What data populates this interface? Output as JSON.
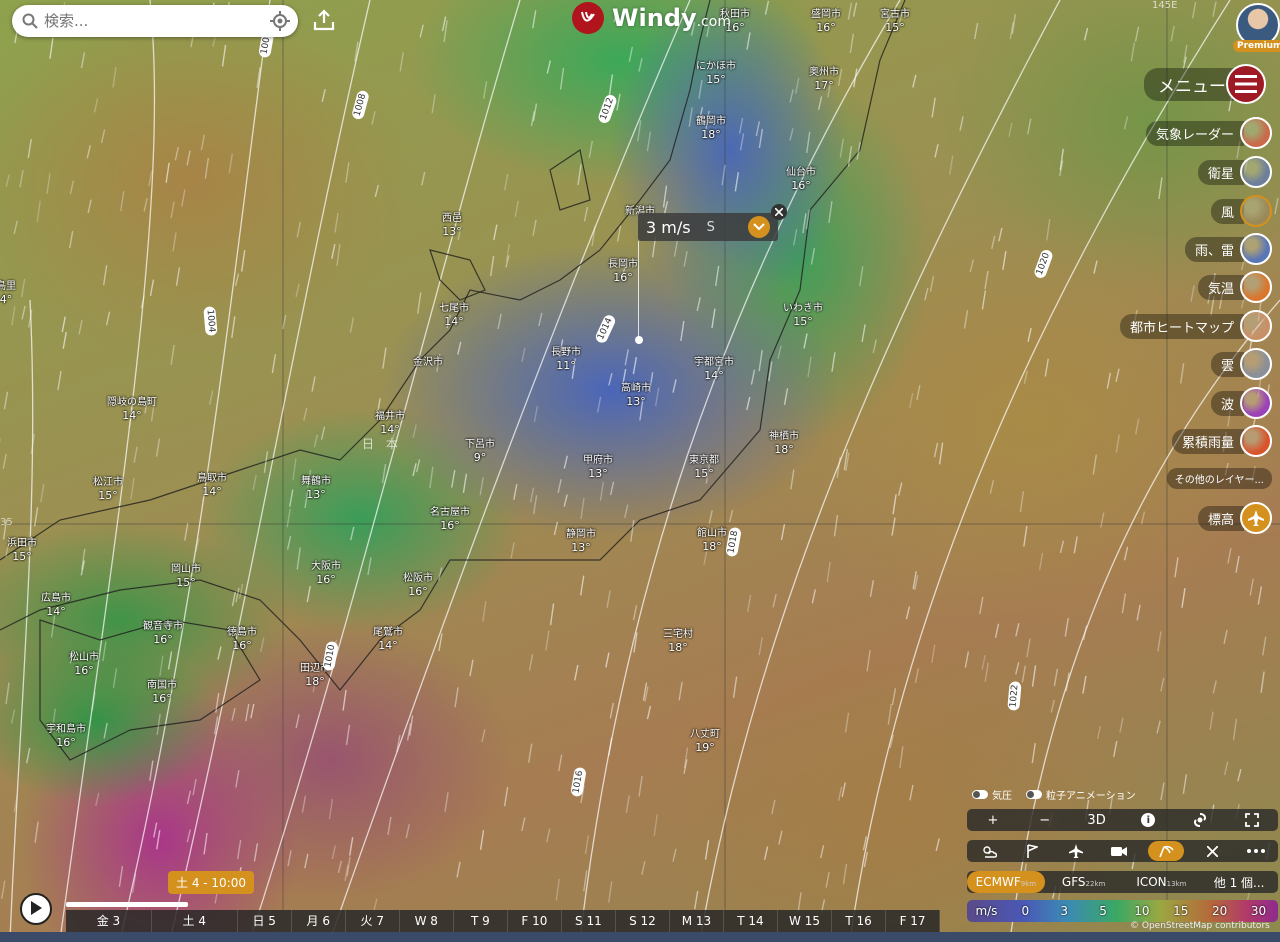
{
  "search": {
    "placeholder": "検索..."
  },
  "logo": {
    "brand": "Windy",
    "suffix": ".com"
  },
  "premium": "Premium",
  "menu": {
    "label": "メニュー"
  },
  "layers": [
    {
      "name": "radar",
      "label": "気象レーダー",
      "color": "#c96a4a"
    },
    {
      "name": "satellite",
      "label": "衛星",
      "color": "#6d7f9a"
    },
    {
      "name": "wind",
      "label": "風",
      "color": "#9a8a5a",
      "active": true
    },
    {
      "name": "rain",
      "label": "雨、雷",
      "color": "#5a76b5"
    },
    {
      "name": "temp",
      "label": "気温",
      "color": "#d9772e"
    },
    {
      "name": "heatmap",
      "label": "都市ヒートマップ",
      "color": "#c99068"
    },
    {
      "name": "clouds",
      "label": "雲",
      "color": "#8a8f98"
    },
    {
      "name": "waves",
      "label": "波",
      "color": "#9b42b8"
    },
    {
      "name": "accum",
      "label": "累積雨量",
      "color": "#d8552c"
    }
  ],
  "more_layers": "その他のレイヤー...",
  "elevation": {
    "label": "標高"
  },
  "popup": {
    "value": "3 m/s",
    "direction": "S"
  },
  "cities": [
    {
      "name": "秋田市",
      "temp": "16°"
    },
    {
      "name": "盛岡市",
      "temp": "16°"
    },
    {
      "name": "宮古市",
      "temp": "15°"
    },
    {
      "name": "にかほ市",
      "temp": "15°"
    },
    {
      "name": "奥州市",
      "temp": "17°"
    },
    {
      "name": "鶴岡市",
      "temp": "18°"
    },
    {
      "name": "仙台市",
      "temp": "16°"
    },
    {
      "name": "新潟市",
      "temp": ""
    },
    {
      "name": "西邑",
      "temp": "13°"
    },
    {
      "name": "長岡市",
      "temp": "16°"
    },
    {
      "name": "いわき市",
      "temp": "15°"
    },
    {
      "name": "七尾市",
      "temp": "14°"
    },
    {
      "name": "長野市",
      "temp": "11°"
    },
    {
      "name": "宇都宮市",
      "temp": "14°"
    },
    {
      "name": "金沢市",
      "temp": ""
    },
    {
      "name": "高崎市",
      "temp": "13°"
    },
    {
      "name": "隠岐の島町",
      "temp": "14°"
    },
    {
      "name": "福井市",
      "temp": "14°"
    },
    {
      "name": "神栖市",
      "temp": "18°"
    },
    {
      "name": "下呂市",
      "temp": "9°"
    },
    {
      "name": "甲府市",
      "temp": "13°"
    },
    {
      "name": "東京都",
      "temp": "15°"
    },
    {
      "name": "松江市",
      "temp": "15°"
    },
    {
      "name": "鳥取市",
      "temp": "14°"
    },
    {
      "name": "舞鶴市",
      "temp": "13°"
    },
    {
      "name": "名古屋市",
      "temp": "16°"
    },
    {
      "name": "浜田市",
      "temp": "15°"
    },
    {
      "name": "静岡市",
      "temp": "13°"
    },
    {
      "name": "館山市",
      "temp": "18°"
    },
    {
      "name": "岡山市",
      "temp": "15°"
    },
    {
      "name": "大阪市",
      "temp": "16°"
    },
    {
      "name": "広島市",
      "temp": "14°"
    },
    {
      "name": "松阪市",
      "temp": "16°"
    },
    {
      "name": "観音寺市",
      "temp": "16°"
    },
    {
      "name": "徳島市",
      "temp": "16°"
    },
    {
      "name": "三宅村",
      "temp": "18°"
    },
    {
      "name": "松山市",
      "temp": "16°"
    },
    {
      "name": "尾鷲市",
      "temp": "14°"
    },
    {
      "name": "田辺市",
      "temp": "18°"
    },
    {
      "name": "南国市",
      "temp": "16°"
    },
    {
      "name": "宇和島市",
      "temp": "16°"
    },
    {
      "name": "八丈町",
      "temp": "19°"
    },
    {
      "name": "鳥里",
      "temp": "4°"
    }
  ],
  "region_label": "日 本",
  "isobars": [
    "1008",
    "1008",
    "1012",
    "1004",
    "1014",
    "1020",
    "1018",
    "1010",
    "1022",
    "1016"
  ],
  "grid_labels": {
    "lon": "145E",
    "lat_left": "35",
    "lat_right": "35"
  },
  "toggles": {
    "pressure": "気圧",
    "particles": "粒子アニメーション"
  },
  "zoom_bar": {
    "plus": "+",
    "minus": "−",
    "mode3d": "3D",
    "info": "i"
  },
  "models": [
    {
      "name": "ECMWF",
      "res": "9km",
      "active": true
    },
    {
      "name": "GFS",
      "res": "22km"
    },
    {
      "name": "ICON",
      "res": "13km"
    },
    {
      "name": "他 1 個...",
      "res": ""
    }
  ],
  "scale": {
    "unit": "m/s",
    "values": [
      "0",
      "3",
      "5",
      "10",
      "15",
      "20",
      "30"
    ]
  },
  "osm": "© OpenStreetMap contributors",
  "timeline": {
    "current": "土 4 - 10:00",
    "days": [
      "金 3",
      "土 4",
      "日 5",
      "月 6",
      "火 7",
      "W 8",
      "T 9",
      "F 10",
      "S 11",
      "S 12",
      "M 13",
      "T 14",
      "W 15",
      "T 16",
      "F 17"
    ],
    "progress": 0.07
  }
}
